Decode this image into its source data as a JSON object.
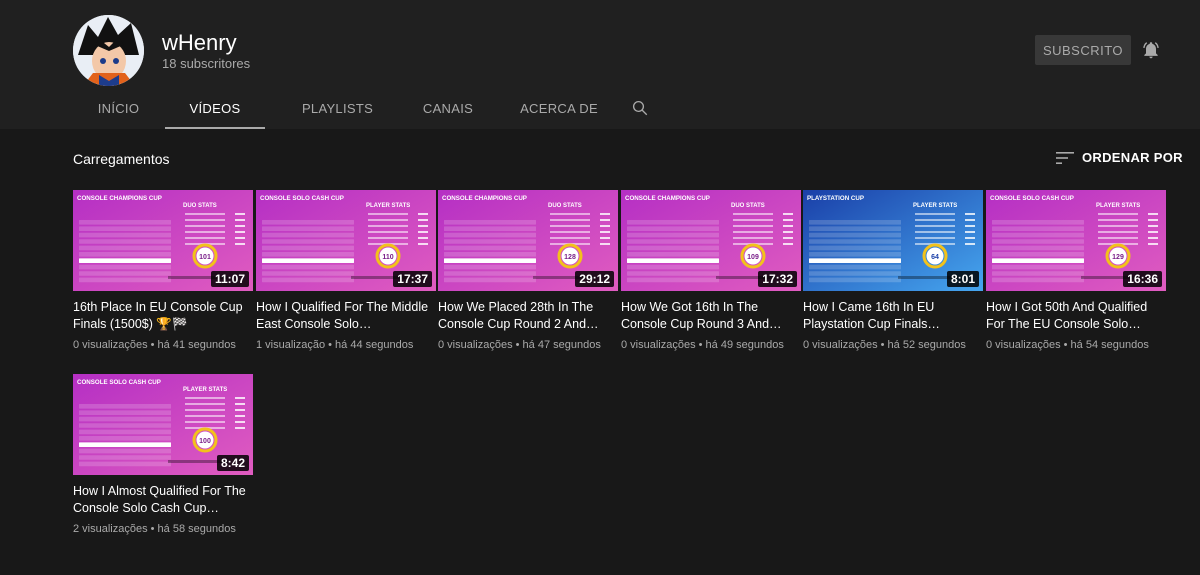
{
  "channel": {
    "name": "wHenry",
    "subscribers": "18 subscritores",
    "subscribe_label": "SUBSCRITO"
  },
  "tabs": [
    {
      "label": "INÍCIO",
      "active": false
    },
    {
      "label": "VÍDEOS",
      "active": true
    },
    {
      "label": "PLAYLISTS",
      "active": false
    },
    {
      "label": "CANAIS",
      "active": false
    },
    {
      "label": "ACERCA DE",
      "active": false
    }
  ],
  "section": {
    "title": "Carregamentos",
    "sort_label": "ORDENAR POR"
  },
  "icons": {
    "bell": "bell-icon",
    "search": "search-icon",
    "sort": "sort-icon"
  },
  "colors": {
    "background": "#181818",
    "header": "#202020",
    "thumb_pink": "#c23bc0",
    "thumb_blue": "#2f6bd6"
  },
  "videos": [
    {
      "title": "16th Place In EU Console Cup Finals (1500$) 🏆🏁",
      "meta": "0 visualizações • há 41 segundos",
      "duration": "11:07",
      "thumb_heading": "CONSOLE CHAMPIONS CUP",
      "thumb_stats": "DUO STATS",
      "thumb_score": "101",
      "theme": "pink"
    },
    {
      "title": "How I Qualified For The Middle East Console Solo…",
      "meta": "1 visualização • há 44 segundos",
      "duration": "17:37",
      "thumb_heading": "CONSOLE SOLO CASH CUP",
      "thumb_stats": "PLAYER STATS",
      "thumb_score": "110",
      "theme": "pink"
    },
    {
      "title": "How We Placed 28th In The Console Cup Round 2 And…",
      "meta": "0 visualizações • há 47 segundos",
      "duration": "29:12",
      "thumb_heading": "CONSOLE CHAMPIONS CUP",
      "thumb_stats": "DUO STATS",
      "thumb_score": "128",
      "theme": "pink"
    },
    {
      "title": "How We Got 16th In The Console Cup Round 3 And…",
      "meta": "0 visualizações • há 49 segundos",
      "duration": "17:32",
      "thumb_heading": "CONSOLE CHAMPIONS CUP",
      "thumb_stats": "DUO STATS",
      "thumb_score": "109",
      "theme": "pink"
    },
    {
      "title": "How I Came 16th In EU Playstation Cup Finals…",
      "meta": "0 visualizações • há 52 segundos",
      "duration": "8:01",
      "thumb_heading": "PLAYSTATION CUP",
      "thumb_stats": "PLAYER STATS",
      "thumb_score": "64",
      "theme": "blue"
    },
    {
      "title": "How I Got 50th And Qualified For The EU Console Solo…",
      "meta": "0 visualizações • há 54 segundos",
      "duration": "16:36",
      "thumb_heading": "CONSOLE SOLO CASH CUP",
      "thumb_stats": "PLAYER STATS",
      "thumb_score": "129",
      "theme": "pink"
    },
    {
      "title": "How I Almost Qualified For The Console Solo Cash Cup…",
      "meta": "2 visualizações • há 58 segundos",
      "duration": "8:42",
      "thumb_heading": "CONSOLE SOLO CASH CUP",
      "thumb_stats": "PLAYER STATS",
      "thumb_score": "100",
      "theme": "pink"
    }
  ]
}
